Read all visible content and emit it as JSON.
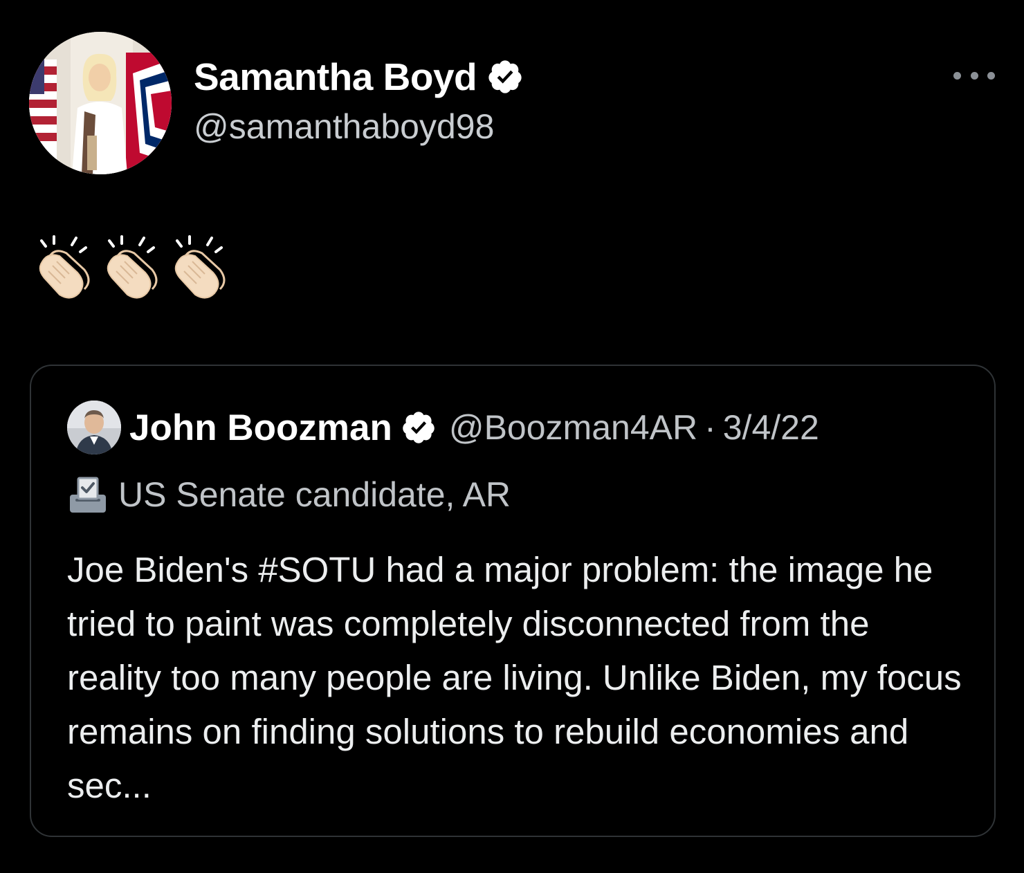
{
  "tweet": {
    "author": {
      "display_name": "Samantha Boyd",
      "handle": "@samanthaboyd98",
      "verified": true,
      "avatar_icon": "user-photo-avatar"
    },
    "more_icon": "more-horizontal-icon",
    "text_emoji": [
      "clapping-hands",
      "clapping-hands",
      "clapping-hands"
    ]
  },
  "quote": {
    "author": {
      "display_name": "John Boozman",
      "handle": "@Boozman4AR",
      "separator": "·",
      "date": "3/4/22",
      "verified": true,
      "avatar_icon": "user-photo-avatar"
    },
    "label": {
      "icon": "ballot-box-icon",
      "text": "US Senate candidate, AR"
    },
    "text": "Joe Biden's #SOTU had a major problem: the image he tried to paint was completely disconnected from the reality too many people are living. Unlike Biden, my focus remains on finding solutions to rebuild economies and sec..."
  },
  "colors": {
    "background": "#000000",
    "verified_badge": "#ffffff",
    "border": "#2f3336",
    "secondary_text": "#c0c4c8"
  }
}
